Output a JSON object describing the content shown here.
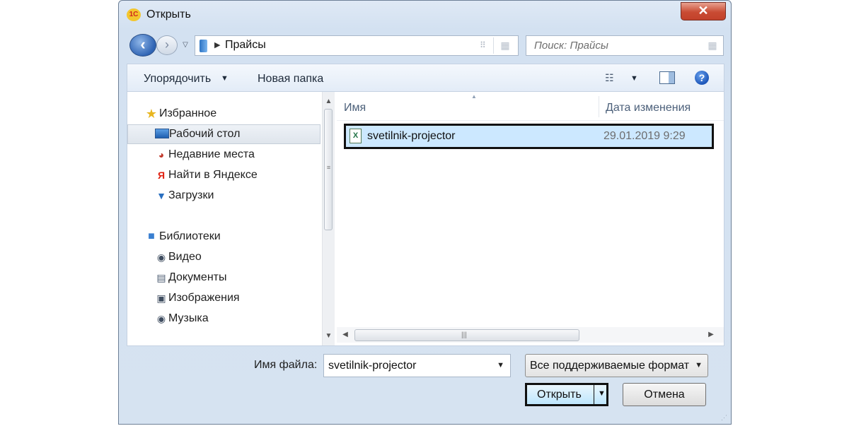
{
  "window": {
    "title": "Открыть",
    "app_icon_text": "1С",
    "close_glyph": "✕"
  },
  "address": {
    "path_segment": "Прайсы",
    "arrow": "▶"
  },
  "search": {
    "placeholder": "Поиск: Прайсы"
  },
  "toolbar": {
    "organize_label": "Упорядочить",
    "new_folder_label": "Новая папка"
  },
  "nav": {
    "favorites": {
      "label": "Избранное",
      "items": [
        {
          "label": "Рабочий стол",
          "selected": true
        },
        {
          "label": "Недавние места"
        },
        {
          "label": "Найти в Яндексе"
        },
        {
          "label": "Загрузки"
        }
      ]
    },
    "libraries": {
      "label": "Библиотеки",
      "items": [
        {
          "label": "Видео"
        },
        {
          "label": "Документы"
        },
        {
          "label": "Изображения"
        },
        {
          "label": "Музыка"
        }
      ]
    }
  },
  "columns": {
    "name": "Имя",
    "date": "Дата изменения"
  },
  "files": [
    {
      "name": "svetilnik-projector",
      "date": "29.01.2019 9:29",
      "selected": true
    }
  ],
  "bottom": {
    "filename_label": "Имя файла:",
    "filename_value": "svetilnik-projector",
    "filetype_value": "Все поддерживаемые формат",
    "open_label": "Открыть",
    "cancel_label": "Отмена"
  },
  "colors": {
    "selection": "#cce8ff",
    "window_frame": "#d3e1f1",
    "close_button": "#c94b33"
  }
}
